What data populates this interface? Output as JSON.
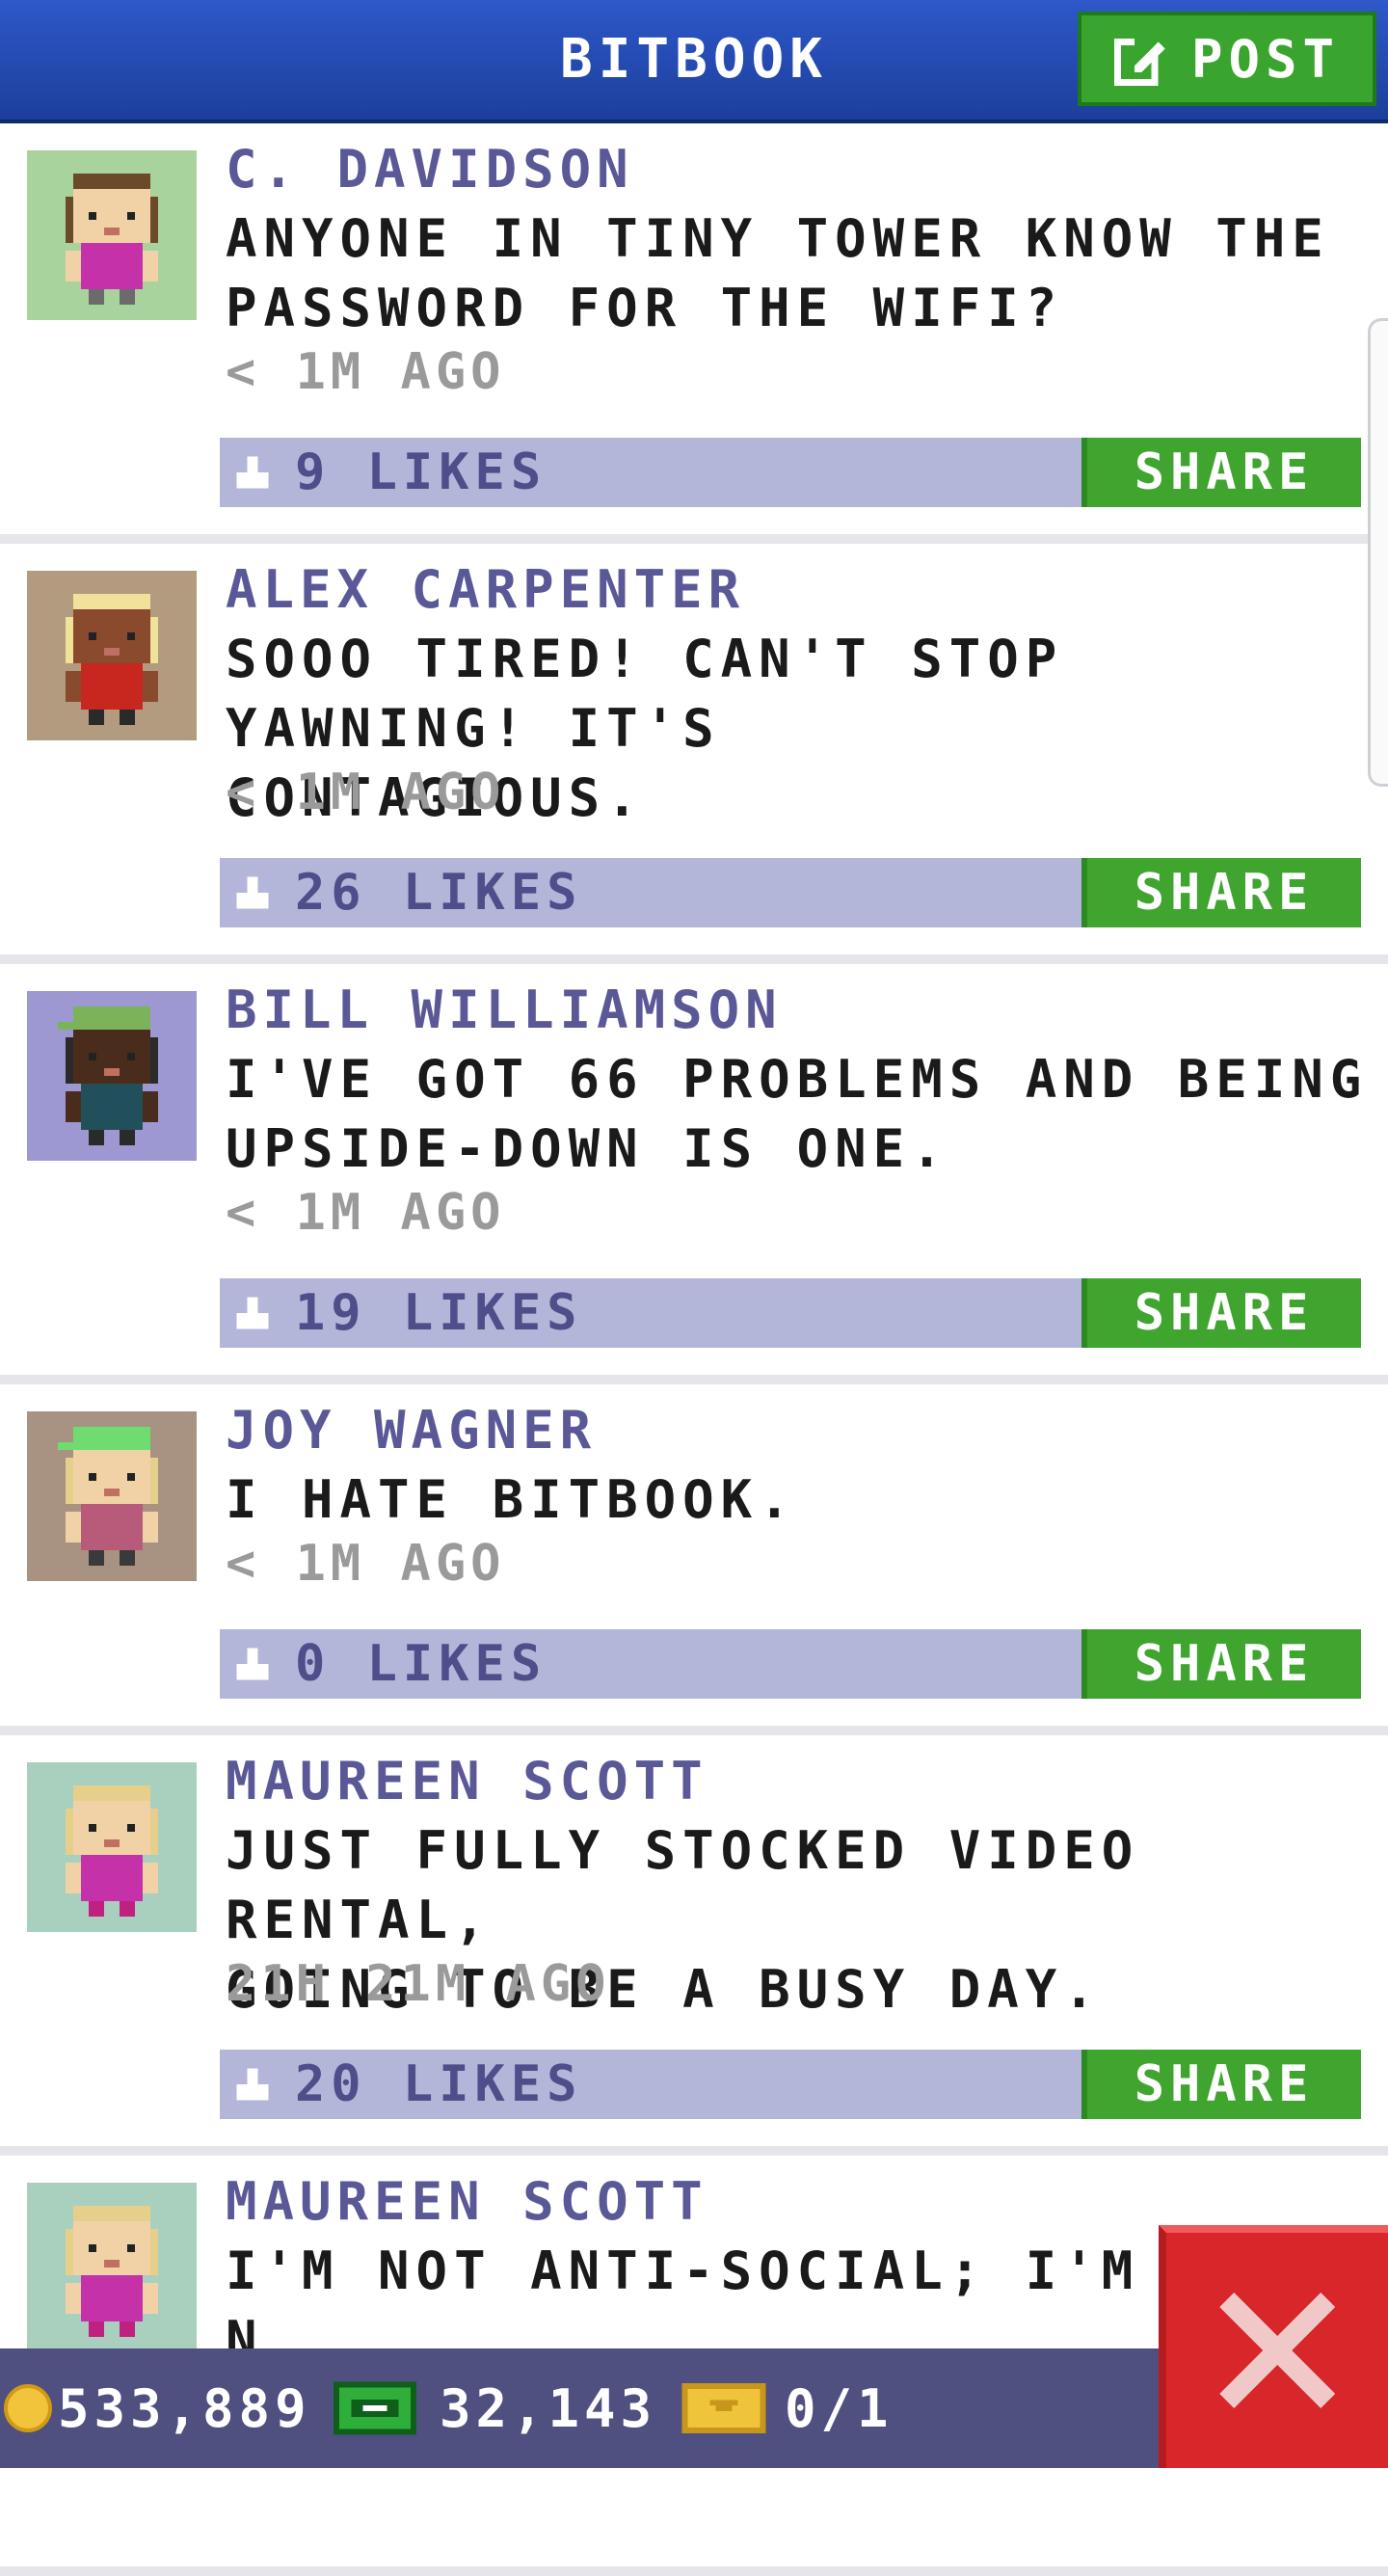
{
  "header": {
    "title": "BITBOOK",
    "post_label": "POST"
  },
  "posts": [
    {
      "author": "C. DAVIDSON",
      "message": "ANYONE IN TINY TOWER KNOW THE\nPASSWORD FOR THE WIFI?",
      "time": "< 1M AGO",
      "likes": "9 LIKES",
      "share": "SHARE",
      "lines": 2
    },
    {
      "author": "ALEX CARPENTER",
      "message": "SOOO TIRED! CAN'T STOP YAWNING! IT'S\nCONTAGIOUS.",
      "time": "< 1M AGO",
      "likes": "26 LIKES",
      "share": "SHARE",
      "lines": 2
    },
    {
      "author": "BILL WILLIAMSON",
      "message": "I'VE GOT 66 PROBLEMS AND BEING\nUPSIDE-DOWN IS ONE.",
      "time": "< 1M AGO",
      "likes": "19 LIKES",
      "share": "SHARE",
      "lines": 2
    },
    {
      "author": "JOY WAGNER",
      "message": "I HATE BITBOOK.",
      "time": "< 1M AGO",
      "likes": "0 LIKES",
      "share": "SHARE",
      "lines": 1
    },
    {
      "author": "MAUREEN SCOTT",
      "message": "JUST FULLY STOCKED VIDEO RENTAL,\nGOING TO BE A BUSY DAY.",
      "time": "21H 21M AGO",
      "likes": "20 LIKES",
      "share": "SHARE",
      "lines": 2
    },
    {
      "author": "MAUREEN SCOTT",
      "message": "I'M NOT ANTI-SOCIAL; I'M JUST N",
      "time": "",
      "likes": "",
      "share": "",
      "lines": 2
    }
  ],
  "avatars": [
    {
      "bg": "#a9d39c",
      "hair": "#6b4a2a",
      "skin": "#f1d2a6",
      "shirt": "#c431a8",
      "pants": "#6b6b6b",
      "hat": ""
    },
    {
      "bg": "#b39b7f",
      "hair": "#f1e29a",
      "skin": "#8a4a2e",
      "shirt": "#c8271f",
      "pants": "#2a2a2a",
      "hat": ""
    },
    {
      "bg": "#9d98d2",
      "hair": "#2a2a2a",
      "skin": "#4a2c1c",
      "shirt": "#22505a",
      "pants": "#2a2a2a",
      "hat": "#7ab35a"
    },
    {
      "bg": "#a89382",
      "hair": "#e6cf8a",
      "skin": "#f1d2a6",
      "shirt": "#b85a7a",
      "pants": "#3a3a3a",
      "hat": "#6fdc6f"
    },
    {
      "bg": "#a9d0bf",
      "hair": "#e6cf8a",
      "skin": "#f1d2a6",
      "shirt": "#c431a8",
      "pants": "#c02080",
      "hat": ""
    },
    {
      "bg": "#a9d0bf",
      "hair": "#e6cf8a",
      "skin": "#f1d2a6",
      "shirt": "#c431a8",
      "pants": "#c02080",
      "hat": ""
    }
  ],
  "status": {
    "coins": "533,889",
    "bux": "32,143",
    "tickets": "0/1"
  },
  "colors": {
    "header": "#2347ad",
    "share": "#3fa52f",
    "likes_bar": "#b4b6d9",
    "author": "#5a5897",
    "close": "#d8262a"
  },
  "icons": {
    "post": "edit-icon",
    "like": "thumbs-up-icon",
    "coin": "coin-icon",
    "bux": "bux-icon",
    "ticket": "ticket-icon",
    "close": "close-icon"
  }
}
